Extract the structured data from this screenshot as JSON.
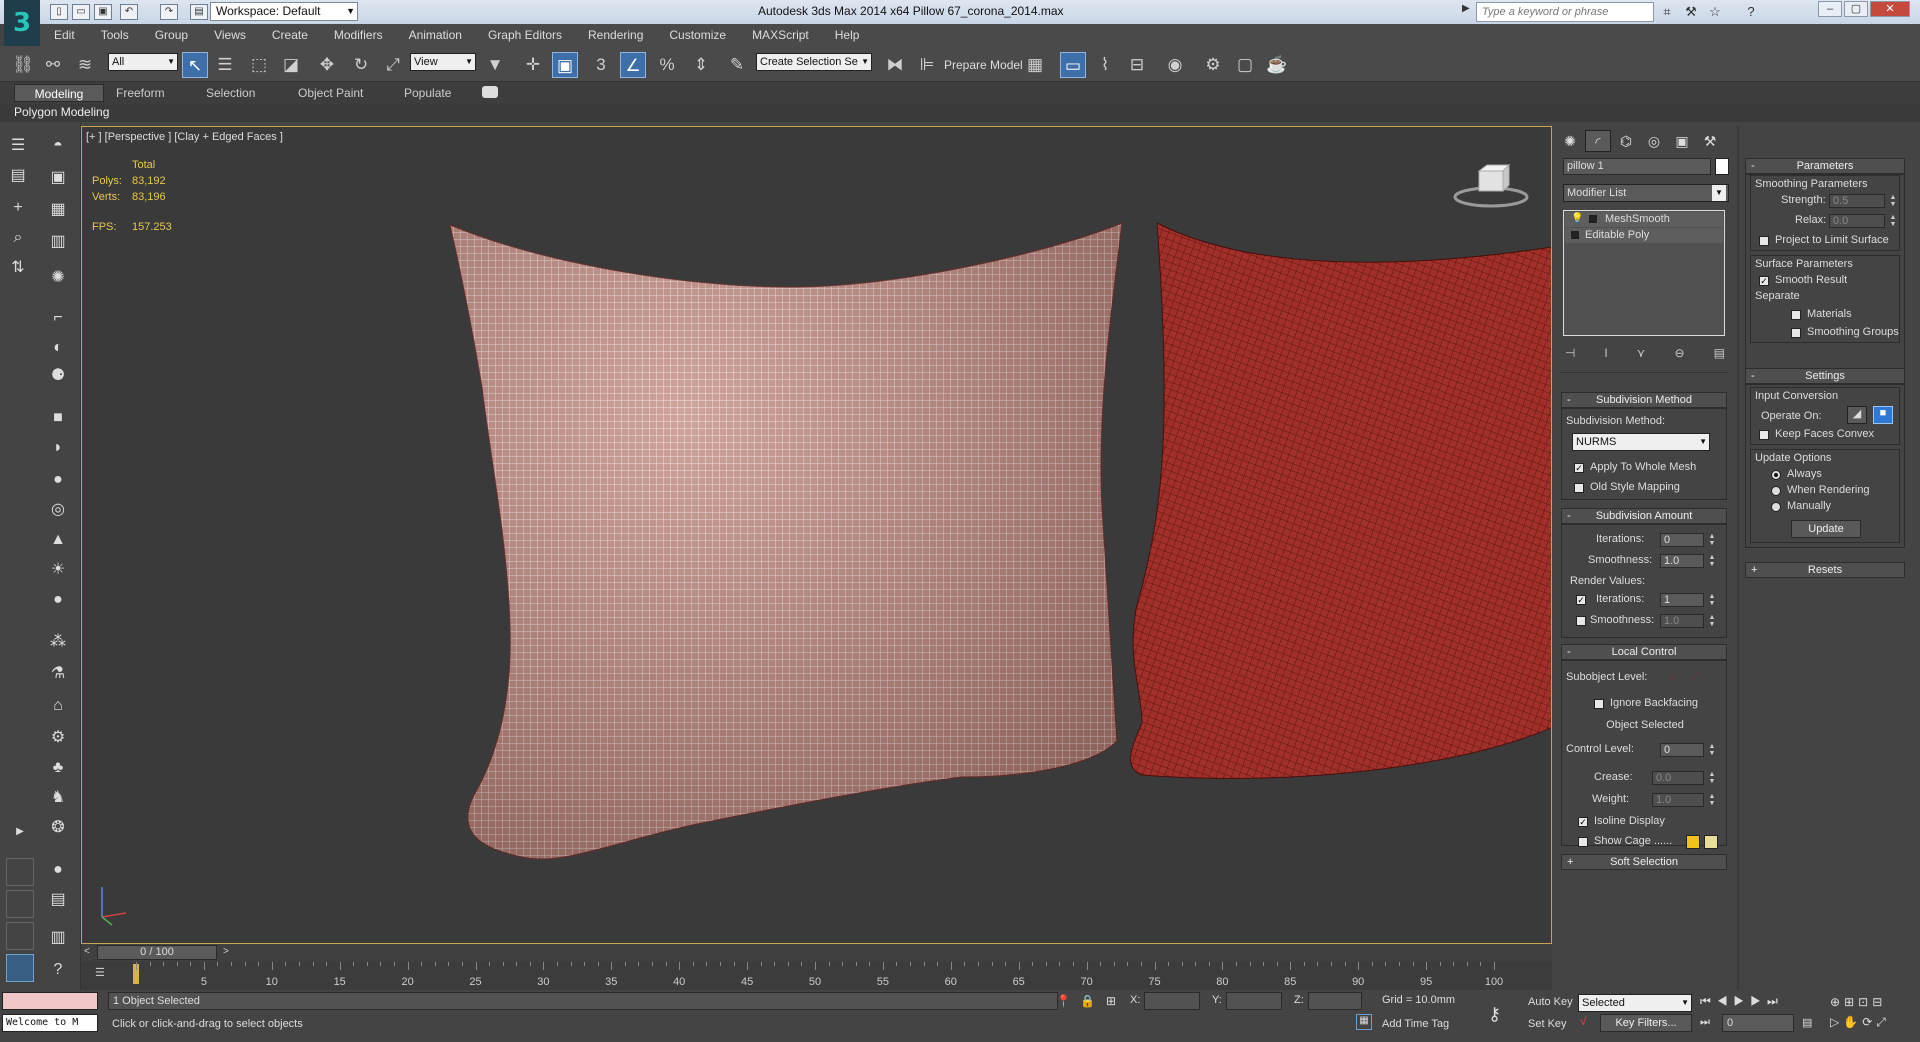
{
  "titlebar": {
    "workspace": "Workspace: Default",
    "app_title": "Autodesk 3ds Max  2014 x64     Pillow 67_corona_2014.max",
    "search_placeholder": "Type a keyword or phrase"
  },
  "menu": [
    "Edit",
    "Tools",
    "Group",
    "Views",
    "Create",
    "Modifiers",
    "Animation",
    "Graph Editors",
    "Rendering",
    "Customize",
    "MAXScript",
    "Help"
  ],
  "toolbar": {
    "selection_filter": "All",
    "ref_coord": "View",
    "named_selection": "Create Selection Se",
    "prepare_model": "Prepare Model",
    "snap_3": "3",
    "snap_pct": "%"
  },
  "ribbon": {
    "tabs": [
      "Modeling",
      "Freeform",
      "Selection",
      "Object Paint",
      "Populate"
    ],
    "active_tab": "Modeling",
    "panel_label": "Polygon Modeling"
  },
  "viewport": {
    "label": "[+ ] [Perspective ] [Clay + Edged Faces ]",
    "stats": {
      "total_label": "Total",
      "polys_label": "Polys:",
      "polys_value": "83,192",
      "verts_label": "Verts:",
      "verts_value": "83,196",
      "fps_label": "FPS:",
      "fps_value": "157.253"
    }
  },
  "timeline": {
    "slider_text": "0 / 100",
    "ticks": [
      "5",
      "10",
      "15",
      "20",
      "25",
      "30",
      "35",
      "40",
      "45",
      "50",
      "55",
      "60",
      "65",
      "70",
      "75",
      "80",
      "85",
      "90",
      "95",
      "100"
    ]
  },
  "command_panel": {
    "object_name": "pillow 1",
    "modifier_list": "Modifier List",
    "stack": [
      "MeshSmooth",
      "Editable Poly"
    ],
    "subdivision_method": {
      "title": "Subdivision Method",
      "method_label": "Subdivision Method:",
      "method_value": "NURMS",
      "apply_whole_mesh": "Apply To Whole Mesh",
      "old_style_mapping": "Old Style Mapping"
    },
    "subdivision_amount": {
      "title": "Subdivision Amount",
      "iterations_label": "Iterations:",
      "iterations_value": "0",
      "smoothness_label": "Smoothness:",
      "smoothness_value": "1.0",
      "render_values_label": "Render Values:",
      "render_iterations_label": "Iterations:",
      "render_iterations_value": "1",
      "render_smoothness_label": "Smoothness:",
      "render_smoothness_value": "1.0"
    },
    "local_control": {
      "title": "Local Control",
      "subobject_label": "Subobject Level:",
      "ignore_backfacing": "Ignore Backfacing",
      "object_selected": "Object Selected",
      "control_level_label": "Control Level:",
      "control_level_value": "0",
      "crease_label": "Crease:",
      "crease_value": "0.0",
      "weight_label": "Weight:",
      "weight_value": "1.0",
      "isoline_display": "Isoline Display",
      "show_cage": "Show Cage ......",
      "cage_color_1": "#f2c21c",
      "cage_color_2": "#e8dd9a"
    },
    "soft_selection": "Soft Selection",
    "parameters": {
      "title": "Parameters",
      "smoothing_params": "Smoothing Parameters",
      "strength_label": "Strength:",
      "strength_value": "0.5",
      "relax_label": "Relax:",
      "relax_value": "0.0",
      "project_limit": "Project to Limit Surface",
      "surface_params": "Surface Parameters",
      "smooth_result": "Smooth Result",
      "separate": "Separate",
      "materials": "Materials",
      "smoothing_groups": "Smoothing Groups"
    },
    "settings": {
      "title": "Settings",
      "input_conversion": "Input Conversion",
      "operate_on": "Operate On:",
      "keep_faces_convex": "Keep Faces Convex",
      "update_options": "Update Options",
      "always": "Always",
      "when_rendering": "When Rendering",
      "manually": "Manually",
      "update_button": "Update"
    },
    "resets": "Resets"
  },
  "status": {
    "listener_text": "Welcome to M",
    "objects_selected": "1 Object Selected",
    "prompt": "Click or click-and-drag to select objects",
    "x_label": "X:",
    "y_label": "Y:",
    "z_label": "Z:",
    "grid": "Grid = 10.0mm",
    "add_time_tag": "Add Time Tag",
    "auto_key": "Auto Key",
    "selected": "Selected",
    "set_key": "Set Key",
    "key_filters": "Key Filters...",
    "frame": "0"
  },
  "colors": {
    "accent": "#3f6fa8",
    "viewport_border": "#caa34a",
    "stats_text": "#e6c84d",
    "pillow_front": "#b87a72",
    "pillow_back": "#9e2a22"
  }
}
